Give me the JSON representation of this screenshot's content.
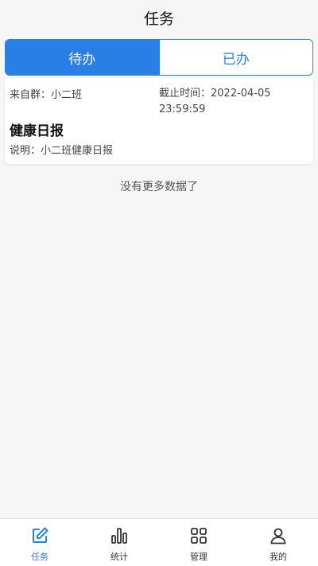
{
  "header": {
    "title": "任务"
  },
  "tabs": [
    {
      "label": "待办",
      "active": true
    },
    {
      "label": "已办",
      "active": false
    }
  ],
  "tasks": [
    {
      "from": "来自群：小二班",
      "deadline": "截止时间：2022-04-05 23:59:59",
      "title": "健康日报",
      "description": "说明：小二班健康日报"
    }
  ],
  "list_footer": "没有更多数据了",
  "bottom_nav": [
    {
      "label": "任务",
      "icon": "edit-icon",
      "active": true
    },
    {
      "label": "统计",
      "icon": "bar-chart-icon",
      "active": false
    },
    {
      "label": "管理",
      "icon": "grid-icon",
      "active": false
    },
    {
      "label": "我的",
      "icon": "user-icon",
      "active": false
    }
  ],
  "colors": {
    "accent": "#2a7fe6",
    "background": "#f6f6f6"
  }
}
